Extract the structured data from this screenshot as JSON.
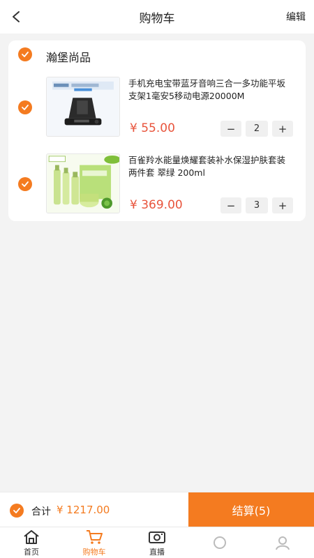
{
  "header": {
    "title": "购物车",
    "edit_label": "编辑"
  },
  "shop": {
    "name": "瀚堡尚品",
    "items": [
      {
        "title": "手机充电宝带蓝牙音响三合一多功能平坂支架1毫安5移动电源20000M",
        "price": "¥ 55.00",
        "quantity": "2",
        "thumb_icon": "phone-stand-image"
      },
      {
        "title": "百雀羚水能量焕耀套装补水保湿护肤套装 两件套 翠绿 200ml",
        "price": "¥ 369.00",
        "quantity": "3",
        "thumb_icon": "skincare-set-image"
      }
    ]
  },
  "stepper": {
    "minus": "−",
    "plus": "+"
  },
  "checkout": {
    "total_label": "合计",
    "total_value": "¥  1217.00",
    "settle_label": "结算(5)"
  },
  "tabs": [
    {
      "label": "首页",
      "icon": "home-icon"
    },
    {
      "label": "购物车",
      "icon": "cart-icon"
    },
    {
      "label": "直播",
      "icon": "live-icon"
    },
    {
      "label": "",
      "icon": "partially-hidden-icon"
    },
    {
      "label": "",
      "icon": "partially-hidden-icon"
    }
  ],
  "colors": {
    "accent": "#f47b20",
    "price": "#e8543c",
    "background": "#f3f3f3"
  }
}
